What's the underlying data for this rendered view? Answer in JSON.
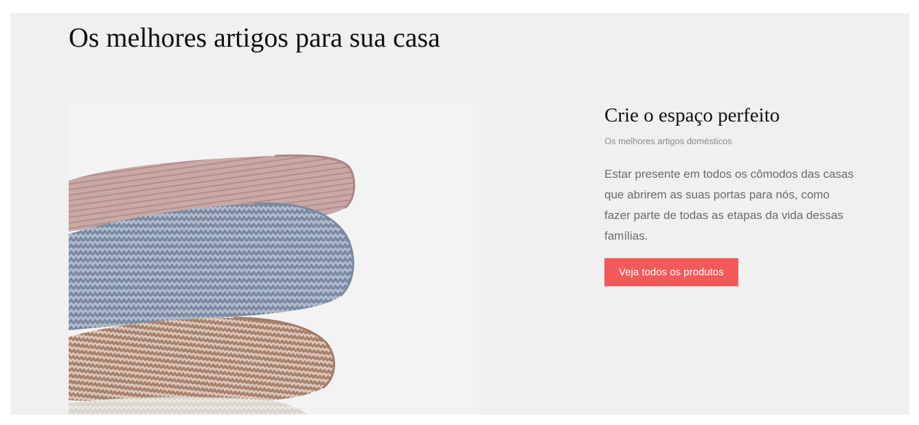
{
  "page": {
    "title": "Os melhores artigos para sua casa"
  },
  "feature": {
    "title": "Crie o espaço perfeito",
    "subtitle": "Os melhores artigos domésticos",
    "body": "Estar presente em todos os cômodos das casas que abrirem as suas portas para nós, como fazer parte de todas as etapas da vida dessas famílias.",
    "button_label": "Veja todos os produtos",
    "image_alt": "stacked-knitted-blankets"
  },
  "colors": {
    "section_bg": "#f0f0f0",
    "accent": "#f25a5a",
    "title_text": "#111111",
    "body_text": "#6a6a6a"
  }
}
